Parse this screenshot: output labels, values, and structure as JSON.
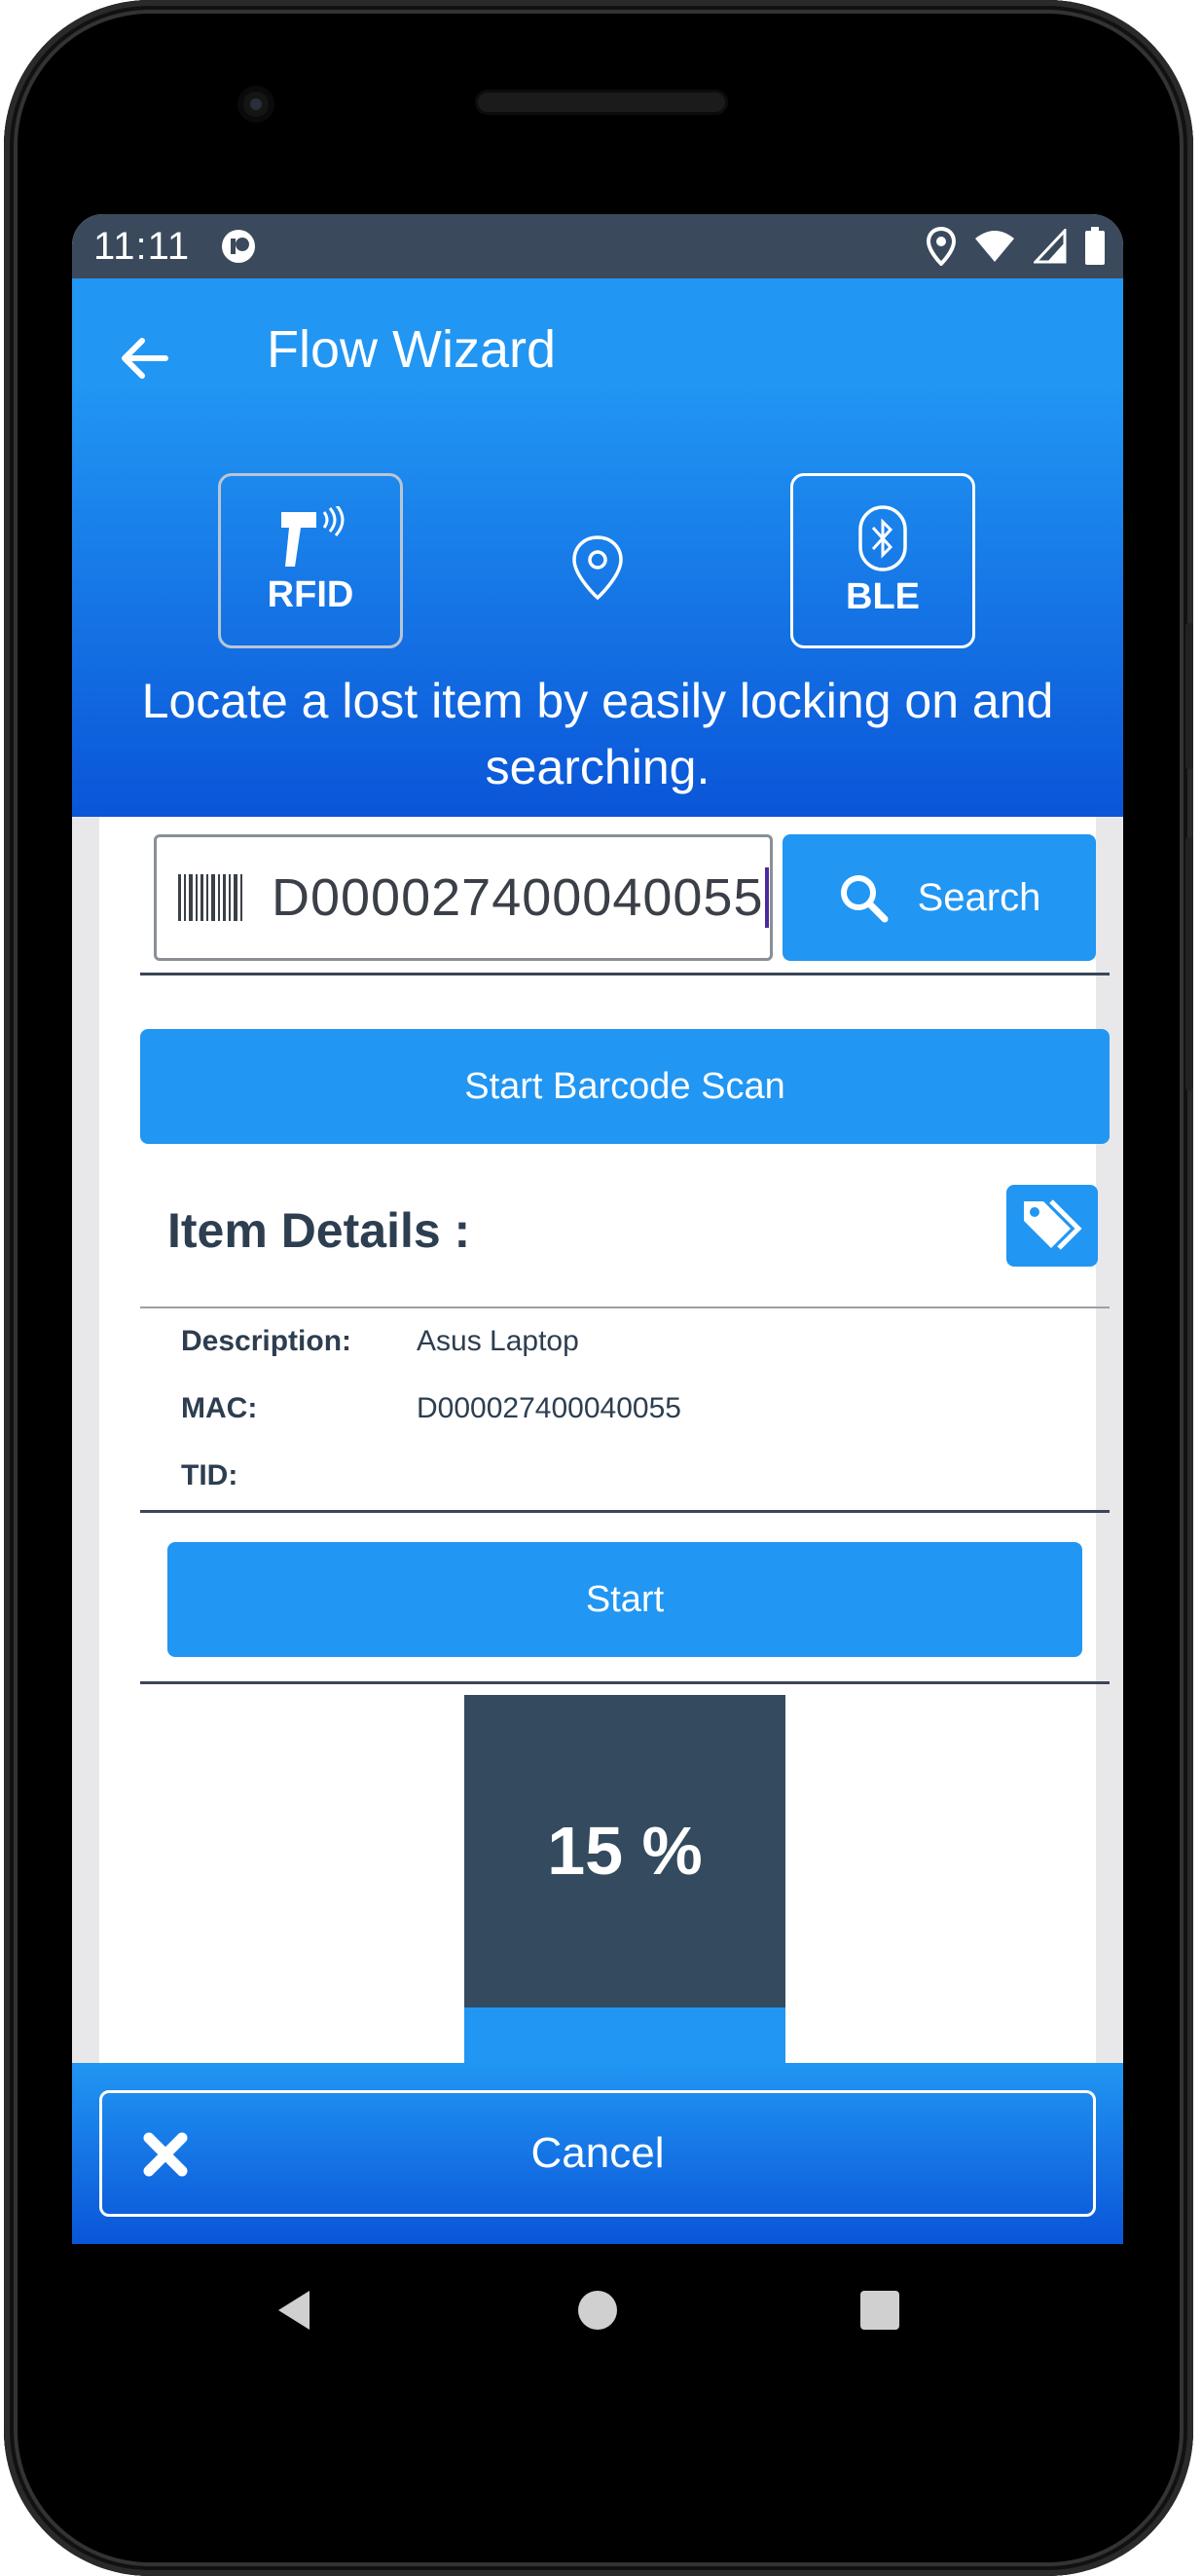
{
  "status": {
    "time": "11:11",
    "icons": [
      "location-icon",
      "wifi-icon",
      "signal-icon",
      "battery-icon"
    ]
  },
  "header": {
    "title": "Flow Wizard",
    "modes": [
      {
        "label": "RFID",
        "icon": "rfid-scanner-icon"
      },
      {
        "label": "BLE",
        "icon": "bluetooth-icon"
      }
    ],
    "tagline": "Locate a lost item by easily locking on and searching."
  },
  "search": {
    "value": "D000027400040055",
    "button_label": "Search"
  },
  "barcode_scan": {
    "button_label": "Start Barcode Scan"
  },
  "item_details": {
    "title": "Item Details :",
    "fields": [
      {
        "label": "Description:",
        "value": "Asus Laptop"
      },
      {
        "label": "MAC:",
        "value": "D000027400040055"
      },
      {
        "label": "TID:",
        "value": ""
      }
    ]
  },
  "start": {
    "button_label": "Start"
  },
  "meter": {
    "text": "15 %",
    "level_percent": 15
  },
  "footer": {
    "cancel_label": "Cancel"
  },
  "colors": {
    "primary": "#2196f3",
    "primary_dark": "#0a55d8",
    "dark_slate": "#344a5e",
    "text_dark": "#2d3e50"
  }
}
